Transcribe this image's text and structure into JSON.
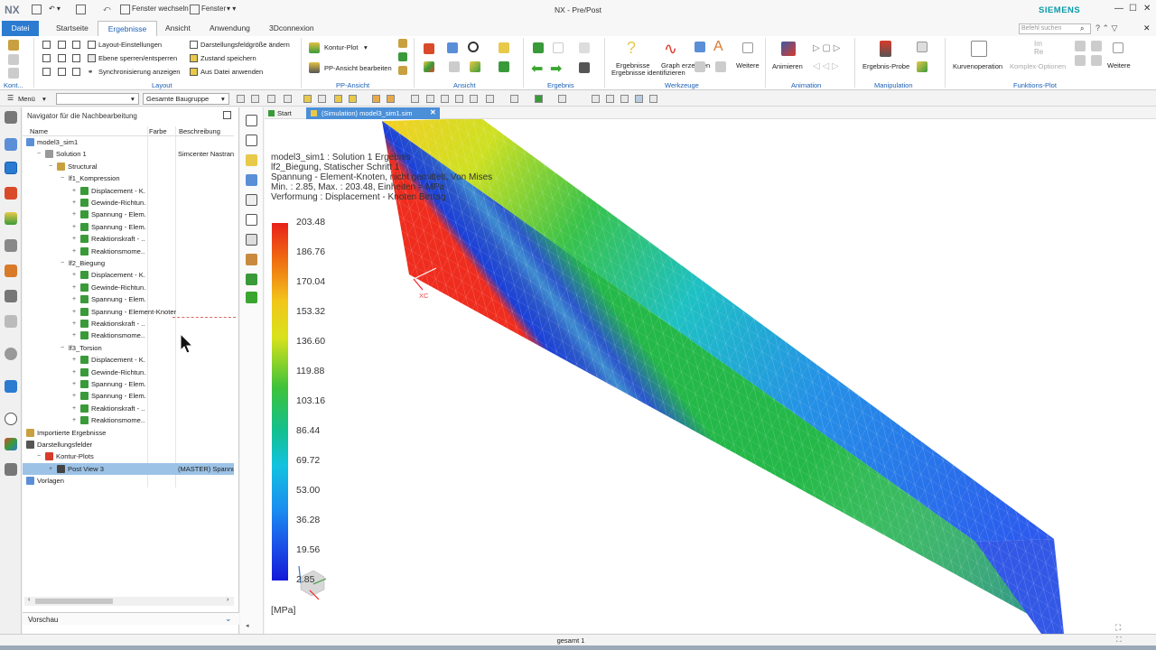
{
  "titlebar": {
    "logo": "NX",
    "window_title": "NX - Pre/Post",
    "brand": "SIEMENS",
    "quick_access": {
      "switch_window": "Fenster wechseln",
      "window_menu": "Fenster"
    }
  },
  "tabs": [
    "Datei",
    "Startseite",
    "Ergebnisse",
    "Ansicht",
    "Anwendung",
    "3Dconnexion"
  ],
  "search_placeholder": "Befehl suchen",
  "ribbon": {
    "layout": {
      "items": [
        "Layout-Einstellungen",
        "Ebene sperren/entsperren",
        "Synchronisierung anzeigen",
        "Darstellungsfeldgröße ändern",
        "Zustand speichern",
        "Aus Datei anwenden"
      ],
      "group_label": "Layout",
      "left_label": "Kont..."
    },
    "pp_ansicht": {
      "items": [
        "Kontur-Plot",
        "PP-Ansicht bearbeiten"
      ],
      "group_label": "PP-Ansicht"
    },
    "ansicht_group_label": "Ansicht",
    "ergebnis_group_label": "Ergebnis",
    "werkzeuge": {
      "items": [
        "Ergebnisse identifizieren",
        "Graph erzeugen",
        "Weitere"
      ],
      "group_label": "Werkzeuge"
    },
    "animation": {
      "items": [
        "Animieren"
      ],
      "group_label": "Animation"
    },
    "manipulation": {
      "items": [
        "Ergebnis-Probe"
      ],
      "group_label": "Manipulation"
    },
    "funktions_plot": {
      "items": [
        "Kurvenoperation",
        "Komplex-Optionen",
        "Weitere"
      ],
      "group_label": "Funktions-Plot"
    }
  },
  "toolbar": {
    "menu_label": "Menü",
    "filter_value": "",
    "scope_value": "Gesamte Baugruppe"
  },
  "navigator": {
    "title": "Navigator für die Nachbearbeitung",
    "columns": [
      "Name",
      "Farbe",
      "Beschreibung"
    ],
    "rows": [
      {
        "label": "model3_sim1",
        "indent": 0,
        "toggle": "",
        "desc": "",
        "icon": "#5a8fd8"
      },
      {
        "label": "Solution 1",
        "indent": 1,
        "toggle": "−",
        "desc": "Simcenter Nastran",
        "icon": "#999999"
      },
      {
        "label": "Structural",
        "indent": 2,
        "toggle": "−",
        "desc": "",
        "icon": "#c9a040"
      },
      {
        "label": "lf1_Kompression",
        "indent": 3,
        "toggle": "−",
        "desc": "",
        "icon": ""
      },
      {
        "label": "Displacement - K...",
        "indent": 4,
        "toggle": "+",
        "desc": "",
        "icon": "#3a9a3a"
      },
      {
        "label": "Gewinde-Richtun...",
        "indent": 4,
        "toggle": "+",
        "desc": "",
        "icon": "#3a9a3a"
      },
      {
        "label": "Spannung - Elem...",
        "indent": 4,
        "toggle": "+",
        "desc": "",
        "icon": "#3a9a3a"
      },
      {
        "label": "Spannung - Elem...",
        "indent": 4,
        "toggle": "+",
        "desc": "",
        "icon": "#3a9a3a"
      },
      {
        "label": "Reaktionskraft - ...",
        "indent": 4,
        "toggle": "+",
        "desc": "",
        "icon": "#3a9a3a"
      },
      {
        "label": "Reaktionsmome...",
        "indent": 4,
        "toggle": "+",
        "desc": "",
        "icon": "#3a9a3a"
      },
      {
        "label": "lf2_Biegung",
        "indent": 3,
        "toggle": "−",
        "desc": "",
        "icon": ""
      },
      {
        "label": "Displacement - K...",
        "indent": 4,
        "toggle": "+",
        "desc": "",
        "icon": "#3a9a3a"
      },
      {
        "label": "Gewinde-Richtun...",
        "indent": 4,
        "toggle": "+",
        "desc": "",
        "icon": "#3a9a3a"
      },
      {
        "label": "Spannung - Elem...",
        "indent": 4,
        "toggle": "+",
        "desc": "",
        "icon": "#3a9a3a"
      },
      {
        "label": "Spannung - Element-Knoten",
        "indent": 4,
        "toggle": "+",
        "desc": "",
        "icon": "#3a9a3a",
        "hover": true
      },
      {
        "label": "Reaktionskraft - ...",
        "indent": 4,
        "toggle": "+",
        "desc": "",
        "icon": "#3a9a3a"
      },
      {
        "label": "Reaktionsmome...",
        "indent": 4,
        "toggle": "+",
        "desc": "",
        "icon": "#3a9a3a"
      },
      {
        "label": "lf3_Torsion",
        "indent": 3,
        "toggle": "−",
        "desc": "",
        "icon": ""
      },
      {
        "label": "Displacement - K...",
        "indent": 4,
        "toggle": "+",
        "desc": "",
        "icon": "#3a9a3a"
      },
      {
        "label": "Gewinde-Richtun...",
        "indent": 4,
        "toggle": "+",
        "desc": "",
        "icon": "#3a9a3a"
      },
      {
        "label": "Spannung - Elem...",
        "indent": 4,
        "toggle": "+",
        "desc": "",
        "icon": "#3a9a3a"
      },
      {
        "label": "Spannung - Elem...",
        "indent": 4,
        "toggle": "+",
        "desc": "",
        "icon": "#3a9a3a"
      },
      {
        "label": "Reaktionskraft - ...",
        "indent": 4,
        "toggle": "+",
        "desc": "",
        "icon": "#3a9a3a"
      },
      {
        "label": "Reaktionsmome...",
        "indent": 4,
        "toggle": "+",
        "desc": "",
        "icon": "#3a9a3a"
      },
      {
        "label": "Importierte Ergebnisse",
        "indent": 0,
        "toggle": "",
        "desc": "",
        "icon": "#c9a040"
      },
      {
        "label": "Darstellungsfelder",
        "indent": 0,
        "toggle": "",
        "desc": "",
        "icon": "#555555"
      },
      {
        "label": "Kontur-Plots",
        "indent": 1,
        "toggle": "−",
        "desc": "",
        "icon": "#d93a2a"
      },
      {
        "label": "Post View 3",
        "indent": 2,
        "toggle": "+",
        "desc": "(MASTER) Spannu",
        "icon": "#444444",
        "selected": true
      },
      {
        "label": "Vorlagen",
        "indent": 0,
        "toggle": "",
        "desc": "",
        "icon": "#5a8fd8"
      }
    ],
    "preview_label": "Vorschau"
  },
  "doc_tabs": {
    "start": "Start",
    "active": "(Simulation) model3_sim1.sim"
  },
  "viewport": {
    "info_lines": [
      "model3_sim1 : Solution 1 Ergebnis",
      "lf2_Biegung, Statischer Schritt 1",
      "Spannung - Element-Knoten, nicht gemittelt, Von Mises",
      "Min. : 2.85, Max. : 203.48, Einheiten = MPa",
      "Verformung : Displacement - Knoten Betrag"
    ],
    "legend_values": [
      "203.48",
      "186.76",
      "170.04",
      "153.32",
      "136.60",
      "119.88",
      "103.16",
      "86.44",
      "69.72",
      "53.00",
      "36.28",
      "19.56",
      "2.85"
    ],
    "unit": "[MPa]",
    "csys_label": "XC"
  },
  "status_text": "gesamt 1"
}
